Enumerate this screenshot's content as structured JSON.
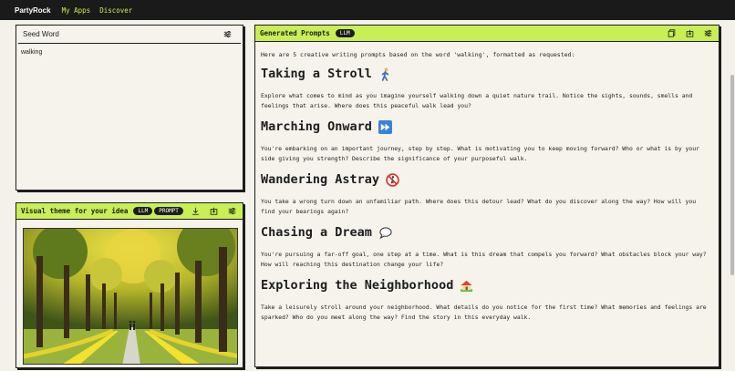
{
  "topbar": {
    "brand": "PartyRock",
    "links": [
      "My Apps",
      "Discover"
    ]
  },
  "seed_card": {
    "title": "Seed Word",
    "value": "walking",
    "icon": "sliders-icon"
  },
  "visual_card": {
    "title": "Visual theme for your idea",
    "badges": [
      "LLM",
      "PROMPT"
    ],
    "icons": [
      "download-icon",
      "share-icon",
      "sliders-icon"
    ],
    "image_alt": "tree-lined path with walkers"
  },
  "prompts_card": {
    "title": "Generated Prompts",
    "badge": "LLM",
    "icons": [
      "copy-icon",
      "share-icon",
      "sliders-icon"
    ],
    "intro": "Here are 5 creative writing prompts based on the word 'walking', formatted as requested:",
    "prompts": [
      {
        "title": "Taking a Stroll",
        "emoji": "person-walking-icon",
        "text": "Explore what comes to mind as you imagine yourself walking down a quiet nature trail. Notice the sights, sounds, smells and feelings that arise. Where does this peaceful walk lead you?"
      },
      {
        "title": "Marching Onward",
        "emoji": "fast-forward-icon",
        "text": "You're embarking on an important journey, step by step. What is motivating you to keep moving forward? Who or what is by your side giving you strength? Describe the significance of your purposeful walk."
      },
      {
        "title": "Wandering Astray",
        "emoji": "no-pedestrians-icon",
        "text": "You take a wrong turn down an unfamiliar path. Where does this detour lead? What do you discover along the way? How will you find your bearings again?"
      },
      {
        "title": "Chasing a Dream",
        "emoji": "speech-bubble-icon",
        "text": "You're pursuing a far-off goal, one step at a time. What is this dream that compels you forward? What obstacles block your way? How will reaching this destination change your life?"
      },
      {
        "title": "Exploring the Neighborhood",
        "emoji": "house-icon",
        "text": "Take a leisurely stroll around your neighborhood. What details do you notice for the first time? What memories and feelings are sparked? Who do you meet along the way? Find the story in this everyday walk."
      }
    ]
  },
  "colors": {
    "accent": "#c8ef55",
    "topbar": "#1a1a1a",
    "background": "#f3f1ea"
  }
}
